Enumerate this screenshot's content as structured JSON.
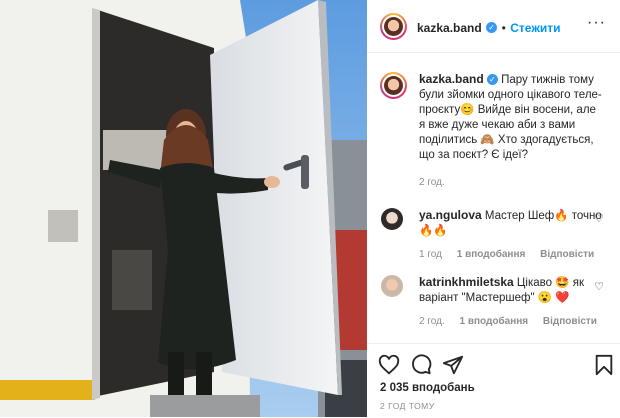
{
  "post": {
    "username": "kazka.band",
    "follow_label": "Стежити",
    "caption_text": "Пару тижнів тому були зйомки одного цікавого теле-проєкту😊 Вийде він восени, але я вже дуже чекаю аби з вами поділитись 🙈 Хто здогадується, що за поєкт? Є ідеї?",
    "caption_time": "2 год."
  },
  "comments": [
    {
      "username": "ya.ngulova",
      "text": "Мастер Шеф🔥 точно🔥🔥",
      "time": "1 год",
      "likes": "1 вподобання",
      "reply": "Відповісти"
    },
    {
      "username": "katrinkhmiletska",
      "text": "Цікаво 🤩 як варіант \"Мастершеф\" 😮 ❤️",
      "time": "2 год.",
      "likes": "1 вподобання",
      "reply": "Відповісти"
    }
  ],
  "footer": {
    "likes_count": "2 035 вподобань",
    "posted_ago": "2 ГОД ТОМУ"
  },
  "icons": [
    "heart-icon",
    "comment-icon",
    "share-icon",
    "bookmark-icon",
    "more-icon",
    "verified-icon"
  ],
  "colors": {
    "link_blue": "#0095f6",
    "verified_blue": "#3897f0",
    "muted": "#8e8e8e"
  }
}
